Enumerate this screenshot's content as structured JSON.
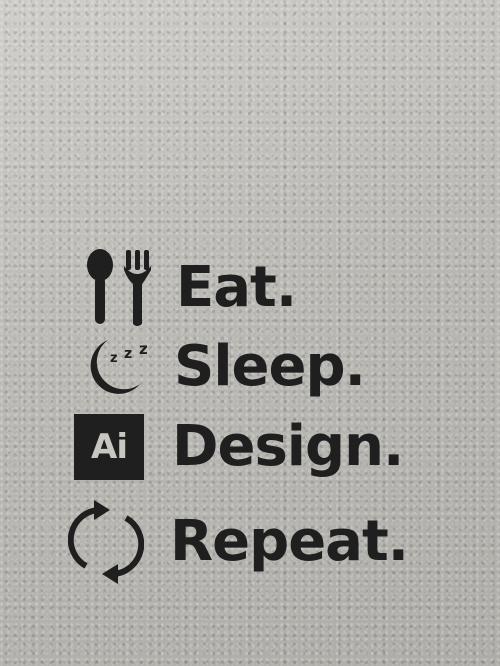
{
  "decal": {
    "color": "#1f1f1f",
    "lines": [
      {
        "word": "Eat.",
        "icon": "spoon-fork-icon"
      },
      {
        "word": "Sleep.",
        "icon": "moon-zzz-icon"
      },
      {
        "word": "Design.",
        "icon": "illustrator-ai-icon",
        "icon_text": "Ai"
      },
      {
        "word": "Repeat.",
        "icon": "refresh-arrows-icon"
      }
    ]
  }
}
